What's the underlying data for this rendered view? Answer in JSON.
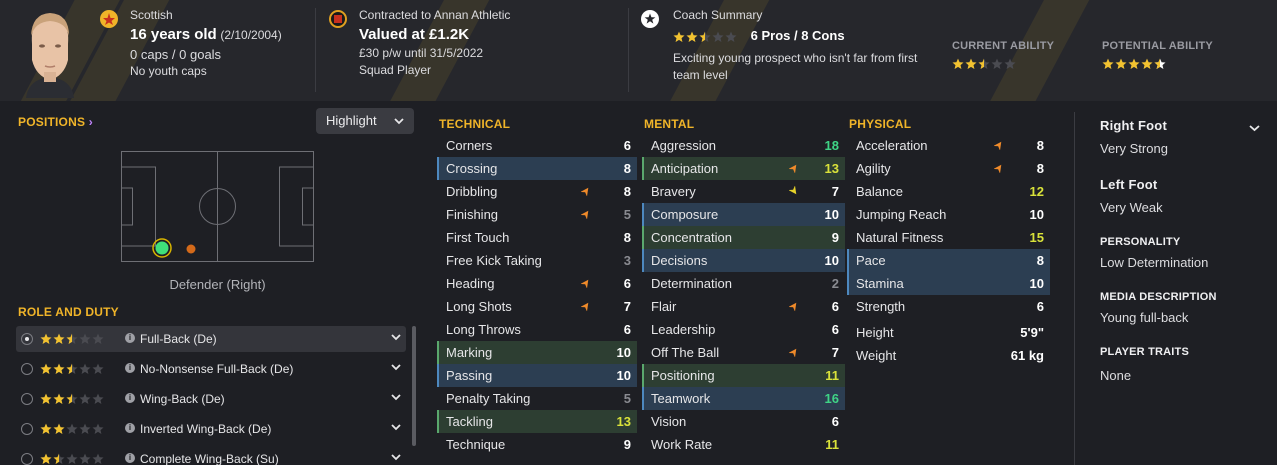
{
  "profile": {
    "nationality": "Scottish",
    "age": "16 years old",
    "dob": "(2/10/2004)",
    "caps_goals": "0 caps / 0 goals",
    "youth_caps": "No youth caps",
    "contract": "Contracted to Annan Athletic",
    "value": "Valued at £1.2K",
    "wage": "£30 p/w until 31/5/2022",
    "squad_status": "Squad Player",
    "coach_title": "Coach Summary",
    "coach_stars": 2.5,
    "coach_pros_cons": "6 Pros / 8 Cons",
    "coach_text_line1": "Exciting young prospect who isn't far from first",
    "coach_text_line2": "team level",
    "current_ability_label": "CURRENT ABILITY",
    "current_ability_stars": 2.5,
    "potential_ability_label": "POTENTIAL ABILITY",
    "potential_ability_stars": 4.5
  },
  "positions": {
    "title": "POSITIONS",
    "highlight_label": "Highlight",
    "position_label": "Defender (Right)"
  },
  "roles": {
    "title": "ROLE AND DUTY",
    "items": [
      {
        "name": "Full-Back (De)",
        "stars": 2.5,
        "selected": true
      },
      {
        "name": "No-Nonsense Full-Back (De)",
        "stars": 2.5,
        "selected": false
      },
      {
        "name": "Wing-Back (De)",
        "stars": 2.5,
        "selected": false
      },
      {
        "name": "Inverted Wing-Back (De)",
        "stars": 2,
        "selected": false
      },
      {
        "name": "Complete Wing-Back (Su)",
        "stars": 1.5,
        "selected": false
      }
    ]
  },
  "technical": {
    "title": "TECHNICAL",
    "rows": [
      {
        "name": "Corners",
        "value": "6",
        "hl": "",
        "arrow": "",
        "color": "white"
      },
      {
        "name": "Crossing",
        "value": "8",
        "hl": "blue",
        "arrow": "",
        "color": "white"
      },
      {
        "name": "Dribbling",
        "value": "8",
        "hl": "",
        "arrow": "up",
        "color": "white"
      },
      {
        "name": "Finishing",
        "value": "5",
        "hl": "",
        "arrow": "up",
        "color": "grey"
      },
      {
        "name": "First Touch",
        "value": "8",
        "hl": "",
        "arrow": "",
        "color": "white"
      },
      {
        "name": "Free Kick Taking",
        "value": "3",
        "hl": "",
        "arrow": "",
        "color": "grey"
      },
      {
        "name": "Heading",
        "value": "6",
        "hl": "",
        "arrow": "up",
        "color": "white"
      },
      {
        "name": "Long Shots",
        "value": "7",
        "hl": "",
        "arrow": "up",
        "color": "white"
      },
      {
        "name": "Long Throws",
        "value": "6",
        "hl": "",
        "arrow": "",
        "color": "white"
      },
      {
        "name": "Marking",
        "value": "10",
        "hl": "green",
        "arrow": "",
        "color": "white"
      },
      {
        "name": "Passing",
        "value": "10",
        "hl": "blue",
        "arrow": "",
        "color": "white"
      },
      {
        "name": "Penalty Taking",
        "value": "5",
        "hl": "",
        "arrow": "",
        "color": "grey"
      },
      {
        "name": "Tackling",
        "value": "13",
        "hl": "green",
        "arrow": "",
        "color": "yellow"
      },
      {
        "name": "Technique",
        "value": "9",
        "hl": "",
        "arrow": "",
        "color": "white"
      }
    ]
  },
  "mental": {
    "title": "MENTAL",
    "rows": [
      {
        "name": "Aggression",
        "value": "18",
        "hl": "",
        "arrow": "",
        "color": "green"
      },
      {
        "name": "Anticipation",
        "value": "13",
        "hl": "green",
        "arrow": "up",
        "color": "yellow"
      },
      {
        "name": "Bravery",
        "value": "7",
        "hl": "",
        "arrow": "down",
        "color": "white"
      },
      {
        "name": "Composure",
        "value": "10",
        "hl": "blue",
        "arrow": "",
        "color": "white"
      },
      {
        "name": "Concentration",
        "value": "9",
        "hl": "green",
        "arrow": "",
        "color": "white"
      },
      {
        "name": "Decisions",
        "value": "10",
        "hl": "blue",
        "arrow": "",
        "color": "white"
      },
      {
        "name": "Determination",
        "value": "2",
        "hl": "",
        "arrow": "",
        "color": "grey"
      },
      {
        "name": "Flair",
        "value": "6",
        "hl": "",
        "arrow": "up",
        "color": "white"
      },
      {
        "name": "Leadership",
        "value": "6",
        "hl": "",
        "arrow": "",
        "color": "white"
      },
      {
        "name": "Off The Ball",
        "value": "7",
        "hl": "",
        "arrow": "up",
        "color": "white"
      },
      {
        "name": "Positioning",
        "value": "11",
        "hl": "green",
        "arrow": "",
        "color": "yellow"
      },
      {
        "name": "Teamwork",
        "value": "16",
        "hl": "blue",
        "arrow": "",
        "color": "green"
      },
      {
        "name": "Vision",
        "value": "6",
        "hl": "",
        "arrow": "",
        "color": "white"
      },
      {
        "name": "Work Rate",
        "value": "11",
        "hl": "",
        "arrow": "",
        "color": "yellow"
      }
    ]
  },
  "physical": {
    "title": "PHYSICAL",
    "rows": [
      {
        "name": "Acceleration",
        "value": "8",
        "hl": "",
        "arrow": "up",
        "color": "white"
      },
      {
        "name": "Agility",
        "value": "8",
        "hl": "",
        "arrow": "up",
        "color": "white"
      },
      {
        "name": "Balance",
        "value": "12",
        "hl": "",
        "arrow": "",
        "color": "yellow"
      },
      {
        "name": "Jumping Reach",
        "value": "10",
        "hl": "",
        "arrow": "",
        "color": "white"
      },
      {
        "name": "Natural Fitness",
        "value": "15",
        "hl": "",
        "arrow": "",
        "color": "yellow"
      },
      {
        "name": "Pace",
        "value": "8",
        "hl": "blue",
        "arrow": "",
        "color": "white"
      },
      {
        "name": "Stamina",
        "value": "10",
        "hl": "blue",
        "arrow": "",
        "color": "white"
      },
      {
        "name": "Strength",
        "value": "6",
        "hl": "",
        "arrow": "",
        "color": "white"
      }
    ],
    "height_label": "Height",
    "height_value": "5'9\"",
    "weight_label": "Weight",
    "weight_value": "61 kg"
  },
  "side": {
    "right_foot_label": "Right Foot",
    "right_foot_value": "Very Strong",
    "left_foot_label": "Left Foot",
    "left_foot_value": "Very Weak",
    "personality_label": "PERSONALITY",
    "personality_value": "Low Determination",
    "media_label": "MEDIA DESCRIPTION",
    "media_value": "Young full-back",
    "traits_label": "PLAYER TRAITS",
    "traits_value": "None"
  },
  "colors": {
    "accent": "#f0b429",
    "star": "#f2c230",
    "highlight_blue": "#2c3e52",
    "highlight_green": "#2d3e32",
    "value_green": "#3fd486",
    "value_yellow": "#d9e23a"
  }
}
